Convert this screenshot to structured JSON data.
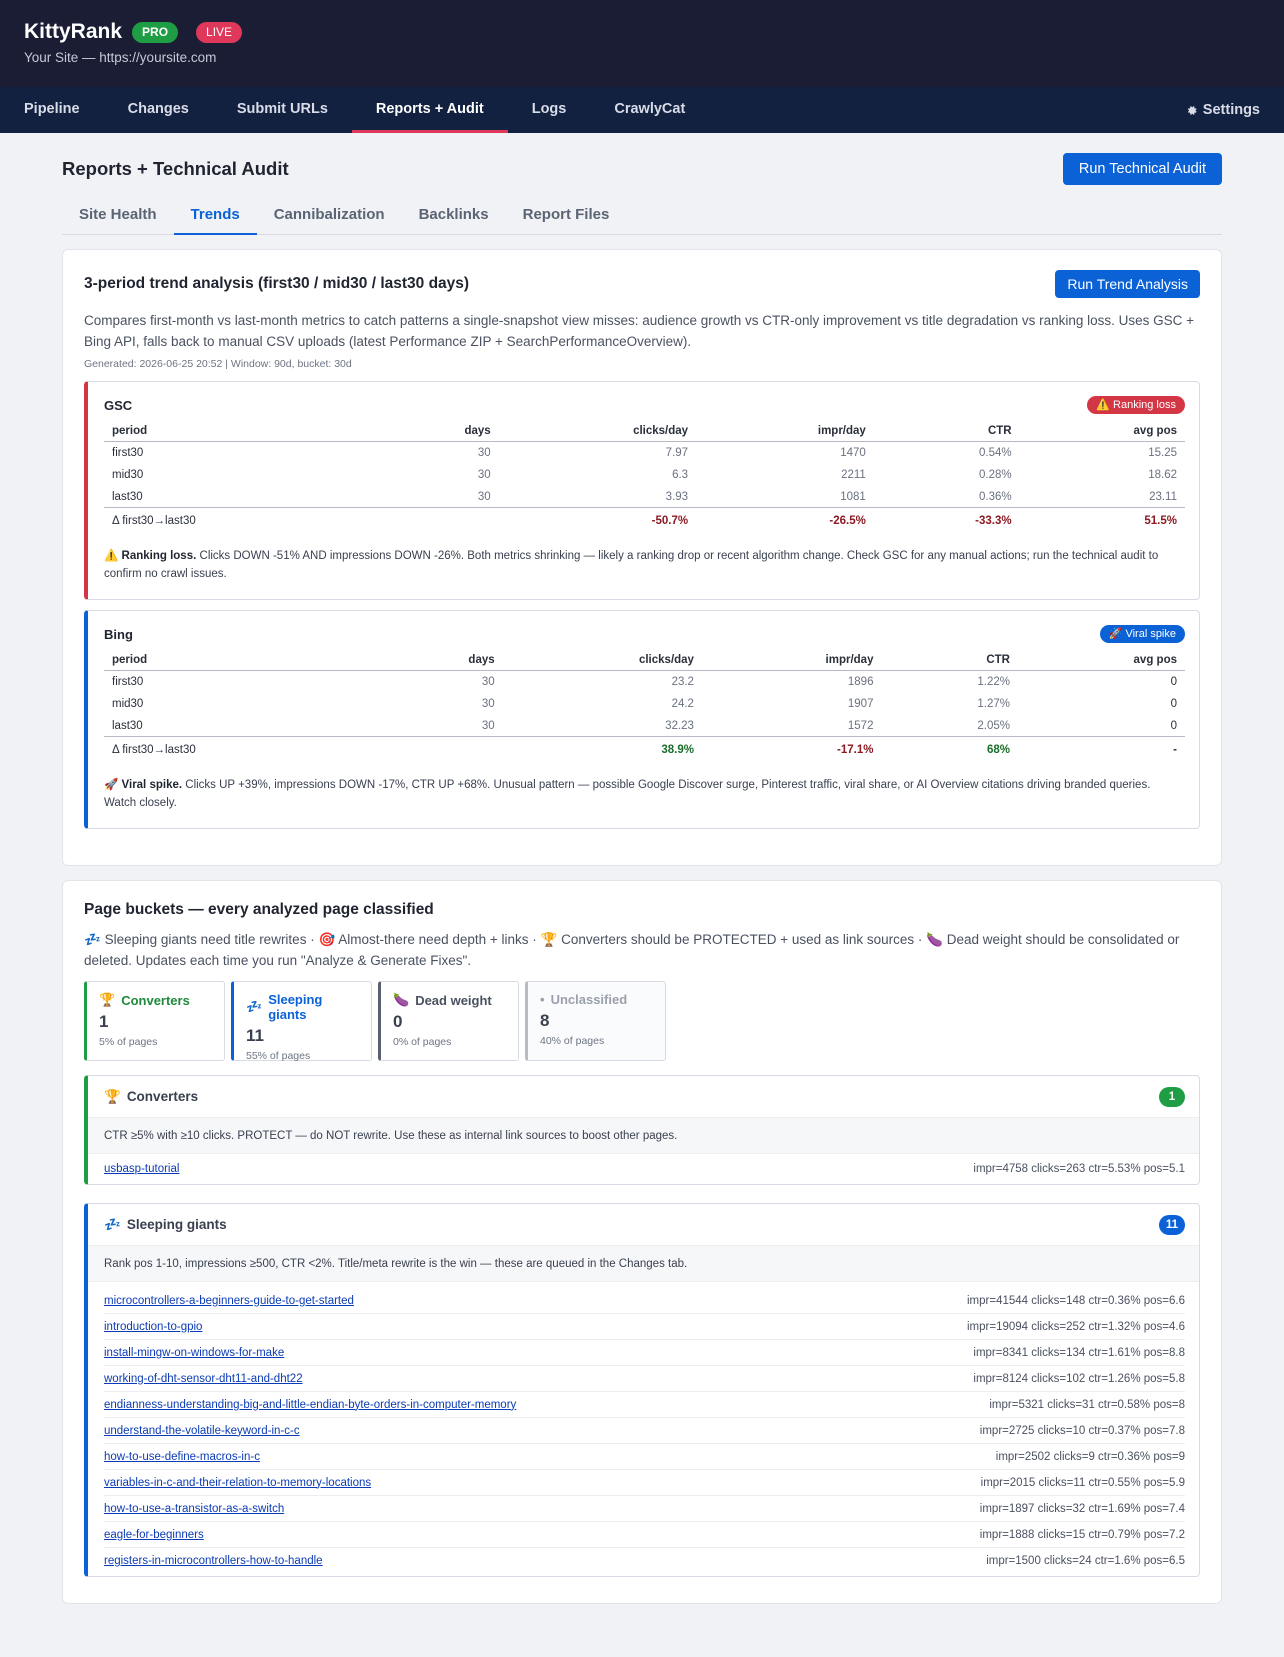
{
  "header": {
    "brand": "KittyRank",
    "pro_badge": "PRO",
    "live_badge": "LIVE",
    "site": "Your Site — https://yoursite.com"
  },
  "nav": {
    "items": [
      "Pipeline",
      "Changes",
      "Submit URLs",
      "Reports + Audit",
      "Logs",
      "CrawlyCat"
    ],
    "active": "Reports + Audit",
    "settings": "Settings",
    "settings_icon": "gear-icon"
  },
  "page": {
    "title": "Reports + Technical Audit",
    "run_audit": "Run Technical Audit",
    "tabs": [
      "Site Health",
      "Trends",
      "Cannibalization",
      "Backlinks",
      "Report Files"
    ],
    "active_tab": "Trends"
  },
  "trend": {
    "title": "3-period trend analysis (first30 / mid30 / last30 days)",
    "run_button": "Run Trend Analysis",
    "description": "Compares first-month vs last-month metrics to catch patterns a single-snapshot view misses: audience growth vs CTR-only improvement vs title degradation vs ranking loss. Uses GSC + Bing API, falls back to manual CSV uploads (latest Performance ZIP + SearchPerformanceOverview).",
    "meta": "Generated: 2026-06-25 20:52  |  Window: 90d, bucket: 30d",
    "columns": [
      "period",
      "days",
      "clicks/day",
      "impr/day",
      "CTR",
      "avg pos"
    ],
    "gsc": {
      "name": "GSC",
      "badge": "Ranking loss",
      "badge_icon": "warning-icon",
      "rows": [
        [
          "first30",
          "30",
          "7.97",
          "1470",
          "0.54%",
          "15.25"
        ],
        [
          "mid30",
          "30",
          "6.3",
          "2211",
          "0.28%",
          "18.62"
        ],
        [
          "last30",
          "30",
          "3.93",
          "1081",
          "0.36%",
          "23.11"
        ]
      ],
      "delta": [
        "Δ first30→last30",
        "",
        "-50.7%",
        "-26.5%",
        "-33.3%",
        "51.5%"
      ],
      "note_title": "Ranking loss.",
      "note": "Clicks DOWN -51% AND impressions DOWN -26%. Both metrics shrinking — likely a ranking drop or recent algorithm change. Check GSC for any manual actions; run the technical audit to confirm no crawl issues."
    },
    "bing": {
      "name": "Bing",
      "badge": "Viral spike",
      "badge_icon": "rocket-icon",
      "rows": [
        [
          "first30",
          "30",
          "23.2",
          "1896",
          "1.22%",
          "0"
        ],
        [
          "mid30",
          "30",
          "24.2",
          "1907",
          "1.27%",
          "0"
        ],
        [
          "last30",
          "30",
          "32.23",
          "1572",
          "2.05%",
          "0"
        ]
      ],
      "delta": [
        "Δ first30→last30",
        "",
        "38.9%",
        "-17.1%",
        "68%",
        "-"
      ],
      "note_title": "Viral spike.",
      "note": "Clicks UP +39%, impressions DOWN -17%, CTR UP +68%. Unusual pattern — possible Google Discover surge, Pinterest traffic, viral share, or AI Overview citations driving branded queries. Watch closely."
    }
  },
  "buckets": {
    "title": "Page buckets — every analyzed page classified",
    "intro_1": "Sleeping giants need title rewrites ·",
    "intro_2": "Almost-there need depth + links ·",
    "intro_3": "Converters should be PROTECTED + used as link sources ·",
    "intro_4": "Dead weight should be consolidated or deleted. Updates each time you run \"Analyze & Generate Fixes\".",
    "stats": [
      {
        "label": "Converters",
        "value": "1",
        "sub": "5% of pages"
      },
      {
        "label": "Sleeping giants",
        "value": "11",
        "sub": "55% of pages"
      },
      {
        "label": "Dead weight",
        "value": "0",
        "sub": "0% of pages"
      },
      {
        "label": "Unclassified",
        "value": "8",
        "sub": "40% of pages"
      }
    ],
    "converters": {
      "title": "Converters",
      "count": "1",
      "desc": "CTR ≥5% with ≥10 clicks. PROTECT — do NOT rewrite. Use these as internal link sources to boost other pages.",
      "pages": [
        {
          "slug": "usbasp-tutorial",
          "stats": "impr=4758 clicks=263 ctr=5.53% pos=5.1"
        }
      ]
    },
    "sleeping": {
      "title": "Sleeping giants",
      "count": "11",
      "desc": "Rank pos 1-10, impressions ≥500, CTR <2%. Title/meta rewrite is the win — these are queued in the Changes tab.",
      "pages": [
        {
          "slug": "microcontrollers-a-beginners-guide-to-get-started",
          "stats": "impr=41544 clicks=148 ctr=0.36% pos=6.6"
        },
        {
          "slug": "introduction-to-gpio",
          "stats": "impr=19094 clicks=252 ctr=1.32% pos=4.6"
        },
        {
          "slug": "install-mingw-on-windows-for-make",
          "stats": "impr=8341 clicks=134 ctr=1.61% pos=8.8"
        },
        {
          "slug": "working-of-dht-sensor-dht11-and-dht22",
          "stats": "impr=8124 clicks=102 ctr=1.26% pos=5.8"
        },
        {
          "slug": "endianness-understanding-big-and-little-endian-byte-orders-in-computer-memory",
          "stats": "impr=5321 clicks=31 ctr=0.58% pos=8"
        },
        {
          "slug": "understand-the-volatile-keyword-in-c-c",
          "stats": "impr=2725 clicks=10 ctr=0.37% pos=7.8"
        },
        {
          "slug": "how-to-use-define-macros-in-c",
          "stats": "impr=2502 clicks=9 ctr=0.36% pos=9"
        },
        {
          "slug": "variables-in-c-and-their-relation-to-memory-locations",
          "stats": "impr=2015 clicks=11 ctr=0.55% pos=5.9"
        },
        {
          "slug": "how-to-use-a-transistor-as-a-switch",
          "stats": "impr=1897 clicks=32 ctr=1.69% pos=7.4"
        },
        {
          "slug": "eagle-for-beginners",
          "stats": "impr=1888 clicks=15 ctr=0.79% pos=7.2"
        },
        {
          "slug": "registers-in-microcontrollers-how-to-handle",
          "stats": "impr=1500 clicks=24 ctr=1.6% pos=6.5"
        }
      ]
    }
  }
}
